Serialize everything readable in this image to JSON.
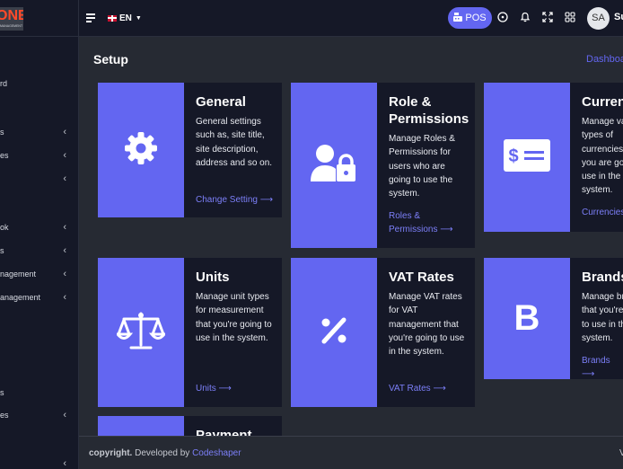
{
  "app": {
    "logo_text": "ONE",
    "logo_subtext": "MANAGEMENT"
  },
  "sidebar": {
    "items": [
      {
        "label": "rd",
        "has_chevron": false
      },
      {
        "label": "s",
        "has_chevron": true
      },
      {
        "label": "es",
        "has_chevron": true
      },
      {
        "label": "",
        "has_chevron": true
      },
      {
        "label": "ok",
        "has_chevron": true
      },
      {
        "label": "s",
        "has_chevron": true
      },
      {
        "label": "nagement",
        "has_chevron": true
      },
      {
        "label": "anagement",
        "has_chevron": true
      },
      {
        "label": "s",
        "has_chevron": false
      },
      {
        "label": "es",
        "has_chevron": true
      },
      {
        "label": "",
        "has_chevron": true
      }
    ],
    "chevron": "‹"
  },
  "header": {
    "language": "EN",
    "pos_label": "POS",
    "avatar_initials": "SA",
    "username": "Su",
    "icons": [
      "menu-icon",
      "plus-circle-icon",
      "bell-icon",
      "fullscreen-icon",
      "apps-grid-icon"
    ]
  },
  "page": {
    "title": "Setup",
    "breadcrumb": "Dashboa"
  },
  "cards": [
    {
      "title": "General",
      "description": "General settings such as, site title, site description, address and so on.",
      "link": "Change Setting ⟶",
      "icon": "gear-icon"
    },
    {
      "title": "Role & Permissions",
      "description": "Manage Roles & Permissions for users who are going to use the system.",
      "link": "Roles & Permissions ⟶",
      "icon": "user-lock-icon"
    },
    {
      "title": "Curren",
      "description": "Manage va types of currencies you are goi use in the system.",
      "link": "Currencies",
      "icon": "money-bill-icon"
    },
    {
      "title": "Units",
      "description": "Manage unit types for measurement that you're going to use in the system.",
      "link": "Units ⟶",
      "icon": "balance-scale-icon"
    },
    {
      "title": "VAT Rates",
      "description": "Manage VAT rates for VAT management that you're going to use in the system.",
      "link": "VAT Rates ⟶",
      "icon": "percent-icon"
    },
    {
      "title": "Brands",
      "description": "Manage br that you're to use in th system.",
      "link": "Brands ⟶",
      "icon": "brand-b-icon"
    },
    {
      "title": "Payment",
      "description": "",
      "link": "",
      "icon": ""
    }
  ],
  "footer": {
    "copyright": "copyright.",
    "developed_by": "Developed by",
    "company": "Codeshaper",
    "right": "V"
  },
  "colors": {
    "accent": "#6366f1",
    "sidebar_bg": "#151827",
    "content_bg": "#262a33",
    "card_bg": "#151827"
  }
}
